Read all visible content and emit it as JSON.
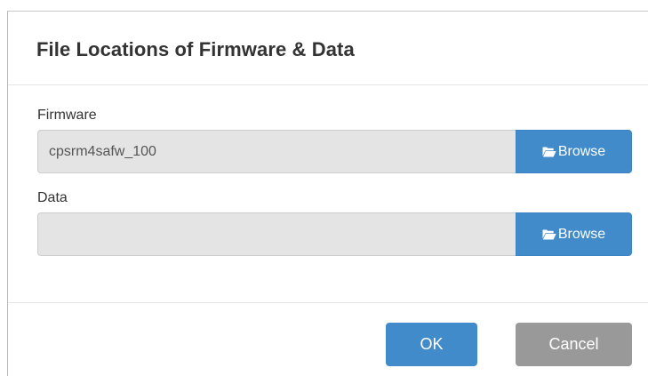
{
  "dialog": {
    "title": "File Locations of Firmware & Data"
  },
  "firmware": {
    "label": "Firmware",
    "value": "cpsrm4safw_100",
    "browse_label": "Browse"
  },
  "data_field": {
    "label": "Data",
    "value": "",
    "browse_label": "Browse"
  },
  "footer": {
    "ok_label": "OK",
    "cancel_label": "Cancel"
  },
  "colors": {
    "primary": "#428bca",
    "secondary": "#999999",
    "input_readonly_bg": "#e4e4e4"
  },
  "icons": {
    "browse": "folder-open-icon"
  }
}
